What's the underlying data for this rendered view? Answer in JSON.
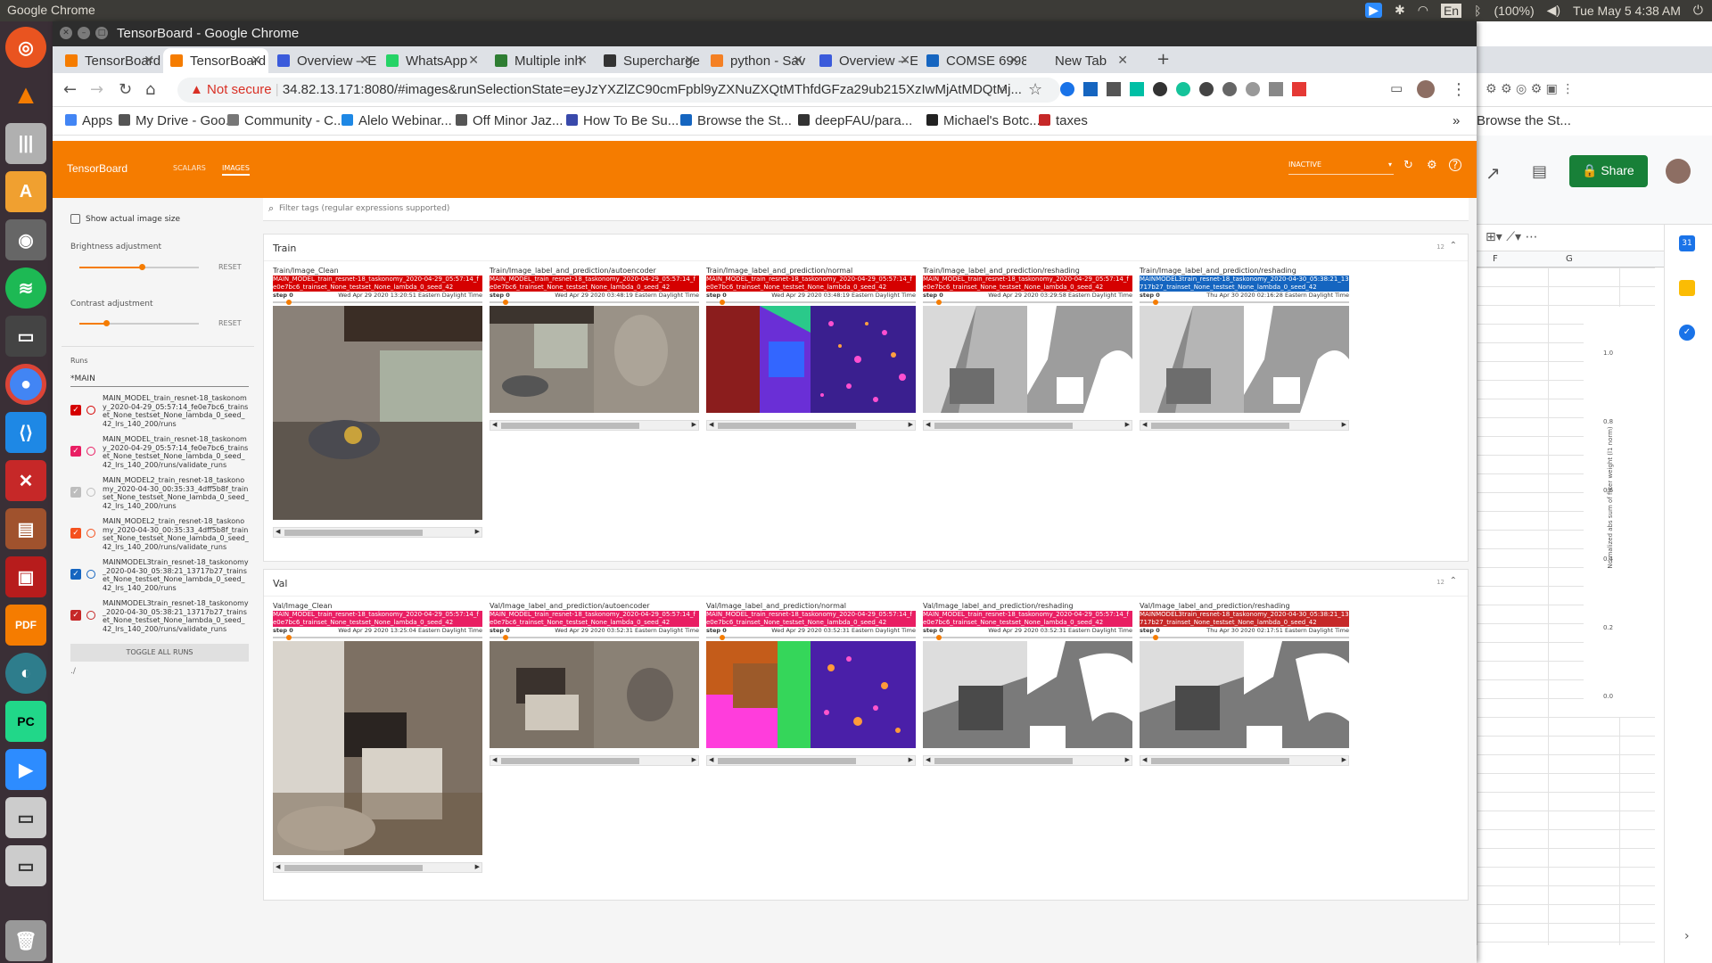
{
  "os": {
    "app_name": "Google Chrome",
    "indicators": [
      "En",
      "(100%)"
    ],
    "clock": "Tue May 5 4:38 AM"
  },
  "window": {
    "title": "TensorBoard - Google Chrome"
  },
  "tabs": [
    {
      "label": "TensorBoard",
      "color": "#f57c00"
    },
    {
      "label": "TensorBoard",
      "color": "#f57c00",
      "active": true
    },
    {
      "label": "Overview – E",
      "color": "#3b5bdb"
    },
    {
      "label": "WhatsApp",
      "color": "#25d366"
    },
    {
      "label": "Multiple inh",
      "color": "#2e7d32"
    },
    {
      "label": "Supercharge",
      "color": "#333333"
    },
    {
      "label": "python - Sav",
      "color": "#f48024"
    },
    {
      "label": "Overview – E",
      "color": "#3b5bdb"
    },
    {
      "label": "COMSE 6998",
      "color": "#1565c0"
    },
    {
      "label": "New Tab",
      "color": "#dee1e6"
    }
  ],
  "address": {
    "security": "Not secure",
    "url": "34.82.13.171:8080/#images&runSelectionState=eyJzYXZlZC90cmFpbl9yZXNuZXQtMThfdGFza29ub215XzIwMjAtMDQtMj..."
  },
  "bookmarks": [
    "Apps",
    "My Drive - Goo...",
    "Community - C...",
    "Alelo Webinar...",
    "Off Minor Jaz...",
    "How To Be Su...",
    "Browse the St...",
    "deepFAU/para...",
    "Michael's Botc...",
    "taxes"
  ],
  "bookmarks_more": "»",
  "tensorboard": {
    "brand": "TensorBoard",
    "nav": [
      "SCALARS",
      "IMAGES"
    ],
    "status": "INACTIVE",
    "sidebar": {
      "show_actual": "Show actual image size",
      "brightness": "Brightness adjustment",
      "contrast": "Contrast adjustment",
      "reset": "RESET",
      "runs_label": "Runs",
      "runs_filter": "*MAIN",
      "toggle_all": "TOGGLE ALL RUNS",
      "footer": "./",
      "runs": [
        {
          "name": "MAIN_MODEL_train_resnet-18_taskonomy_2020-04-29_05:57:14_fe0e7bc6_trainset_None_testset_None_lambda_0_seed_42_lrs_140_200/runs",
          "color": "#d50000",
          "checked": true
        },
        {
          "name": "MAIN_MODEL_train_resnet-18_taskonomy_2020-04-29_05:57:14_fe0e7bc6_trainset_None_testset_None_lambda_0_seed_42_lrs_140_200/runs/validate_runs",
          "color": "#e91e63",
          "checked": true
        },
        {
          "name": "MAIN_MODEL2_train_resnet-18_taskonomy_2020-04-30_00:35:33_4dff5b8f_trainset_None_testset_None_lambda_0_seed_42_lrs_140_200/runs",
          "color": "#bdbdbd",
          "checked": true
        },
        {
          "name": "MAIN_MODEL2_train_resnet-18_taskonomy_2020-04-30_00:35:33_4dff5b8f_trainset_None_testset_None_lambda_0_seed_42_lrs_140_200/runs/validate_runs",
          "color": "#f4511e",
          "checked": true
        },
        {
          "name": "MAINMODEL3train_resnet-18_taskonomy_2020-04-30_05:38:21_13717b27_trainset_None_testset_None_lambda_0_seed_42_lrs_140_200/runs",
          "color": "#1565c0",
          "checked": true
        },
        {
          "name": "MAINMODEL3train_resnet-18_taskonomy_2020-04-30_05:38:21_13717b27_trainset_None_testset_None_lambda_0_seed_42_lrs_140_200/runs/validate_runs",
          "color": "#c62828",
          "checked": true
        }
      ]
    },
    "filter_placeholder": "Filter tags (regular expressions supported)",
    "sections": [
      {
        "name": "Train",
        "count": "12",
        "items": [
          {
            "tag": "Train/Image_Clean",
            "run": "MAIN_MODEL_train_resnet-18_taskonomy_2020-04-29_05:57:14_fe0e7bc6_trainset_None_testset_None_lambda_0_seed_42",
            "run_color": "#d50000",
            "step": "step 0",
            "time": "Wed Apr 29 2020 13:20:51 Eastern Daylight Time",
            "kind": "clean"
          },
          {
            "tag": "Train/Image_label_and_prediction/autoencoder",
            "run": "MAIN_MODEL_train_resnet-18_taskonomy_2020-04-29_05:57:14_fe0e7bc6_trainset_None_testset_None_lambda_0_seed_42",
            "run_color": "#d50000",
            "step": "step 0",
            "time": "Wed Apr 29 2020 03:48:19 Eastern Daylight Time",
            "kind": "auto"
          },
          {
            "tag": "Train/Image_label_and_prediction/normal",
            "run": "MAIN_MODEL_train_resnet-18_taskonomy_2020-04-29_05:57:14_fe0e7bc6_trainset_None_testset_None_lambda_0_seed_42",
            "run_color": "#d50000",
            "step": "step 0",
            "time": "Wed Apr 29 2020 03:48:19 Eastern Daylight Time",
            "kind": "normal"
          },
          {
            "tag": "Train/Image_label_and_prediction/reshading",
            "run": "MAIN_MODEL_train_resnet-18_taskonomy_2020-04-29_05:57:14_fe0e7bc6_trainset_None_testset_None_lambda_0_seed_42",
            "run_color": "#d50000",
            "step": "step 0",
            "time": "Wed Apr 29 2020 03:29:58 Eastern Daylight Time",
            "kind": "reshade"
          },
          {
            "tag": "Train/Image_label_and_prediction/reshading",
            "run": "MAINMODEL3train_resnet-18_taskonomy_2020-04-30_05:38:21_13717b27_trainset_None_testset_None_lambda_0_seed_42",
            "run_color": "#1565c0",
            "step": "step 0",
            "time": "Thu Apr 30 2020 02:16:28 Eastern Daylight Time",
            "kind": "reshade"
          }
        ]
      },
      {
        "name": "Val",
        "count": "12",
        "items": [
          {
            "tag": "Val/Image_Clean",
            "run": "MAIN_MODEL_train_resnet-18_taskonomy_2020-04-29_05:57:14_fe0e7bc6_trainset_None_testset_None_lambda_0_seed_42",
            "run_color": "#e91e63",
            "step": "step 0",
            "time": "Wed Apr 29 2020 13:25:04 Eastern Daylight Time",
            "kind": "clean2"
          },
          {
            "tag": "Val/Image_label_and_prediction/autoencoder",
            "run": "MAIN_MODEL_train_resnet-18_taskonomy_2020-04-29_05:57:14_fe0e7bc6_trainset_None_testset_None_lambda_0_seed_42",
            "run_color": "#e91e63",
            "step": "step 0",
            "time": "Wed Apr 29 2020 03:52:31 Eastern Daylight Time",
            "kind": "auto2"
          },
          {
            "tag": "Val/Image_label_and_prediction/normal",
            "run": "MAIN_MODEL_train_resnet-18_taskonomy_2020-04-29_05:57:14_fe0e7bc6_trainset_None_testset_None_lambda_0_seed_42",
            "run_color": "#e91e63",
            "step": "step 0",
            "time": "Wed Apr 29 2020 03:52:31 Eastern Daylight Time",
            "kind": "normal2"
          },
          {
            "tag": "Val/Image_label_and_prediction/reshading",
            "run": "MAIN_MODEL_train_resnet-18_taskonomy_2020-04-29_05:57:14_fe0e7bc6_trainset_None_testset_None_lambda_0_seed_42",
            "run_color": "#e91e63",
            "step": "step 0",
            "time": "Wed Apr 29 2020 03:52:31 Eastern Daylight Time",
            "kind": "reshade2"
          },
          {
            "tag": "Val/Image_label_and_prediction/reshading",
            "run": "MAINMODEL3train_resnet-18_taskonomy_2020-04-30_05:38:21_13717b27_trainset_None_testset_None_lambda_0_seed_42",
            "run_color": "#c62828",
            "step": "step 0",
            "time": "Thu Apr 30 2020 02:17:51 Eastern Daylight Time",
            "kind": "reshade2"
          }
        ]
      }
    ]
  },
  "background_sheet": {
    "browse": "Browse the St...",
    "share": "Share",
    "cols": [
      "F",
      "G"
    ],
    "yticks": [
      "1.0",
      "0.8",
      "0.6",
      "0.4",
      "0.2",
      "0.0"
    ],
    "ylabel": "Normalized abs sum of filter weight (l1 norm)"
  }
}
